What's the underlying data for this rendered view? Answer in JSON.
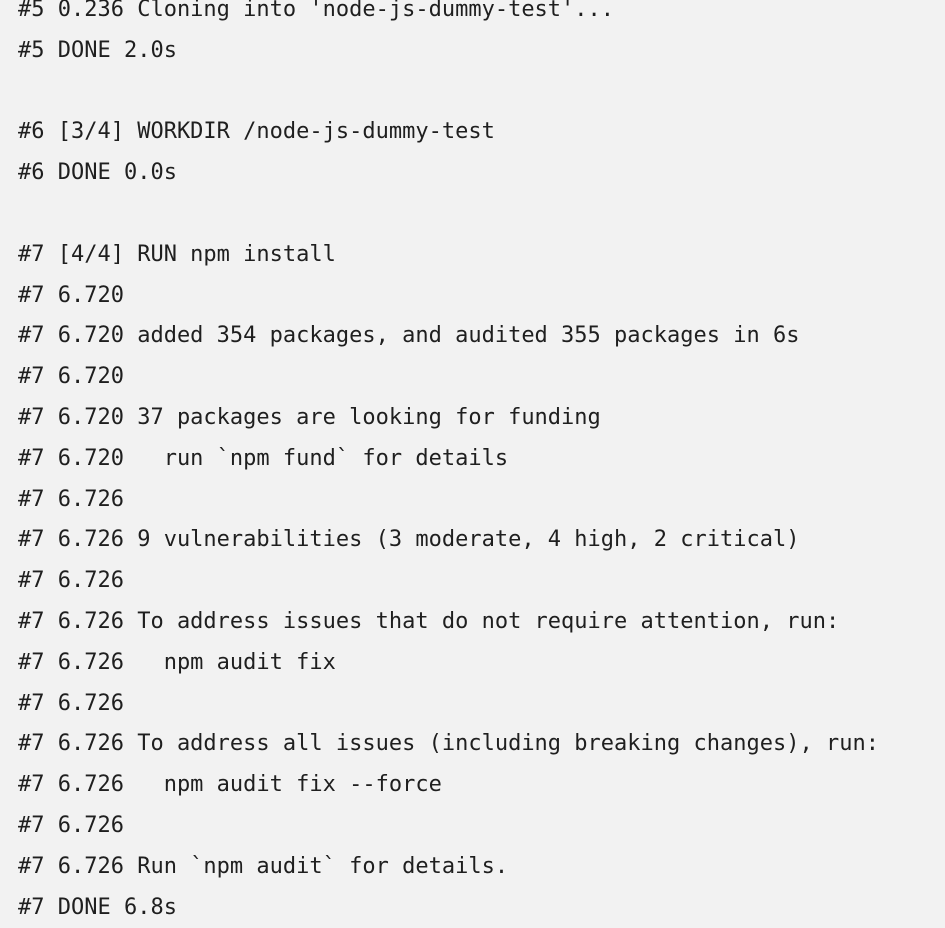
{
  "log": {
    "lines": [
      "#5 0.236 Cloning into 'node-js-dummy-test'...",
      "#5 DONE 2.0s",
      "",
      "#6 [3/4] WORKDIR /node-js-dummy-test",
      "#6 DONE 0.0s",
      "",
      "#7 [4/4] RUN npm install",
      "#7 6.720",
      "#7 6.720 added 354 packages, and audited 355 packages in 6s",
      "#7 6.720",
      "#7 6.720 37 packages are looking for funding",
      "#7 6.720   run `npm fund` for details",
      "#7 6.726",
      "#7 6.726 9 vulnerabilities (3 moderate, 4 high, 2 critical)",
      "#7 6.726",
      "#7 6.726 To address issues that do not require attention, run:",
      "#7 6.726   npm audit fix",
      "#7 6.726",
      "#7 6.726 To address all issues (including breaking changes), run:",
      "#7 6.726   npm audit fix --force",
      "#7 6.726",
      "#7 6.726 Run `npm audit` for details.",
      "#7 DONE 6.8s"
    ]
  }
}
